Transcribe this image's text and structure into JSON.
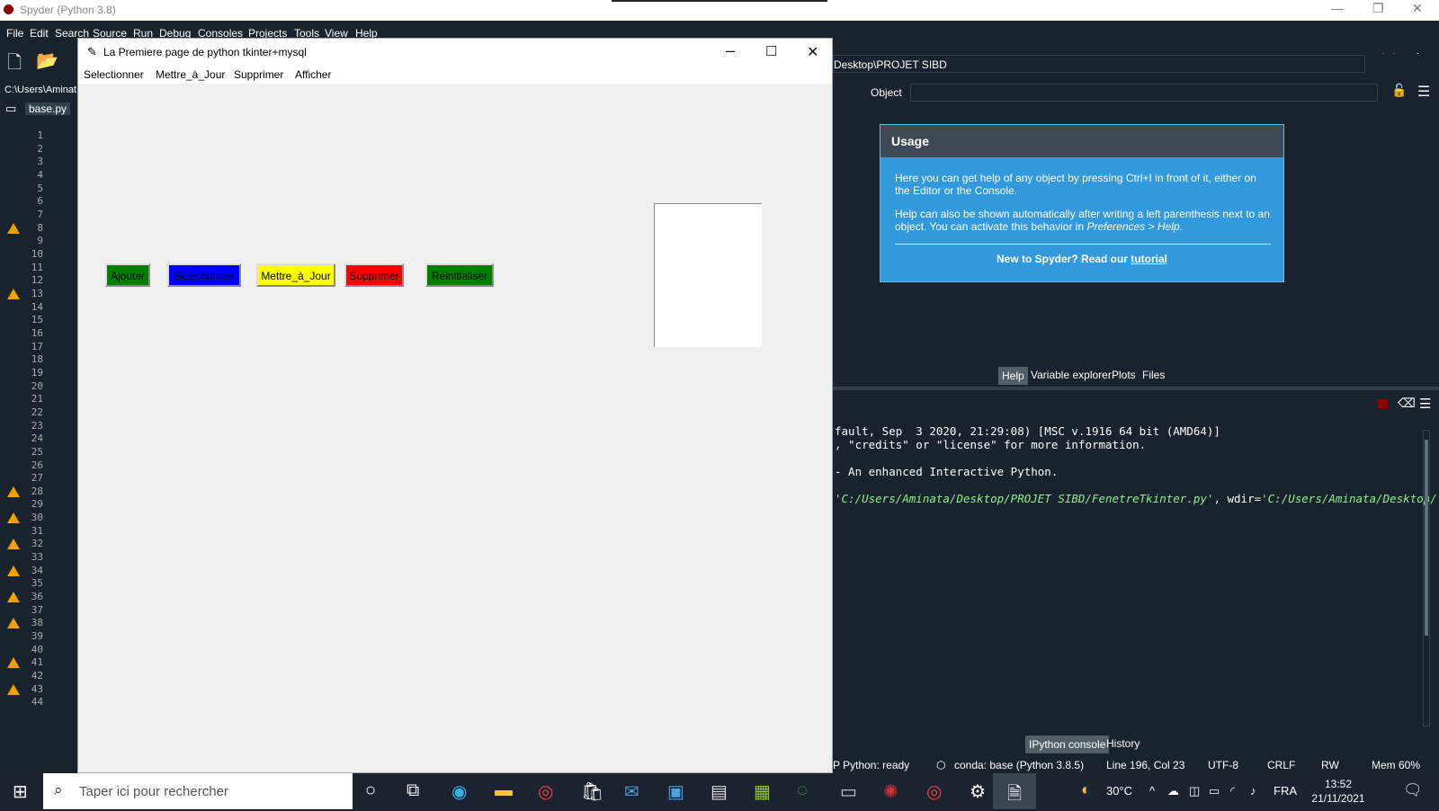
{
  "spyder": {
    "title": "Spyder (Python 3.8)",
    "menu": [
      "File",
      "Edit",
      "Search",
      "Source",
      "Run",
      "Debug",
      "Consoles",
      "Projects",
      "Tools",
      "View",
      "Help"
    ],
    "editor_path": "C:\\Users\\Aminat",
    "editor_tab": "base.py",
    "line_numbers": [
      "1",
      "2",
      "3",
      "4",
      "5",
      "6",
      "7",
      "8",
      "9",
      "10",
      "11",
      "12",
      "13",
      "14",
      "15",
      "16",
      "17",
      "18",
      "19",
      "20",
      "21",
      "22",
      "23",
      "24",
      "25",
      "26",
      "27",
      "28",
      "29",
      "30",
      "31",
      "32",
      "33",
      "34",
      "35",
      "36",
      "37",
      "38",
      "39",
      "40",
      "41",
      "42",
      "43",
      "44"
    ],
    "warning_lines": [
      8,
      13,
      28,
      30,
      32,
      34,
      36,
      38,
      41,
      43
    ],
    "help_path": "Desktop\\PROJET SIBD",
    "object_label": "Object",
    "usage": {
      "heading": "Usage",
      "para1": "Here you can get help of any object by pressing Ctrl+I in front of it, either on the Editor or the Console.",
      "para2_a": "Help can also be shown automatically after writing a left parenthesis next to an object. You can activate this behavior in ",
      "para2_b": "Preferences > Help",
      "para2_c": ".",
      "foot_text": "New to Spyder? Read our ",
      "foot_link": "tutorial"
    },
    "pane_tabs": [
      "Help",
      "Variable explorer",
      "Plots",
      "Files"
    ],
    "console_lines": [
      "fault, Sep  3 2020, 21:29:08) [MSC v.1916 64 bit (AMD64)]",
      ", \"credits\" or \"license\" for more information.",
      "- An enhanced Interactive Python."
    ],
    "console_run_a": "'C:/Users/Aminata/Desktop/PROJET SIBD/FenetreTkinter.py'",
    "console_run_b": ", wdir=",
    "console_run_c": "'C:/Users/Aminata/Desktop/",
    "console_tabs": [
      "IPython console",
      "History"
    ],
    "status": {
      "python": "P Python: ready",
      "conda": "conda: base (Python 3.8.5)",
      "position": "Line 196, Col 23",
      "encoding": "UTF-8",
      "eol": "CRLF",
      "perm": "RW",
      "mem": "Mem 60%"
    }
  },
  "tk": {
    "title": "La Premiere page de python tkinter+mysql",
    "menu": [
      "Selectionner",
      "Mettre_à_Jour",
      "Supprimer",
      "Afficher"
    ],
    "buttons": [
      {
        "label": "Ajouter",
        "bg": "#008000",
        "fg": "#000000"
      },
      {
        "label": "Selectionner",
        "bg": "#0000ff",
        "fg": "#000000"
      },
      {
        "label": "Mettre_à_Jour",
        "bg": "#ffff00",
        "fg": "#000000"
      },
      {
        "label": "Supprimer",
        "bg": "#ff0000",
        "fg": "#000000"
      },
      {
        "label": "Reinitialiser",
        "bg": "#008000",
        "fg": "#000000"
      }
    ]
  },
  "taskbar": {
    "search_placeholder": "Taper ici pour rechercher",
    "weather": "30°C",
    "lang": "FRA",
    "time": "13:52",
    "date": "21/11/2021"
  }
}
